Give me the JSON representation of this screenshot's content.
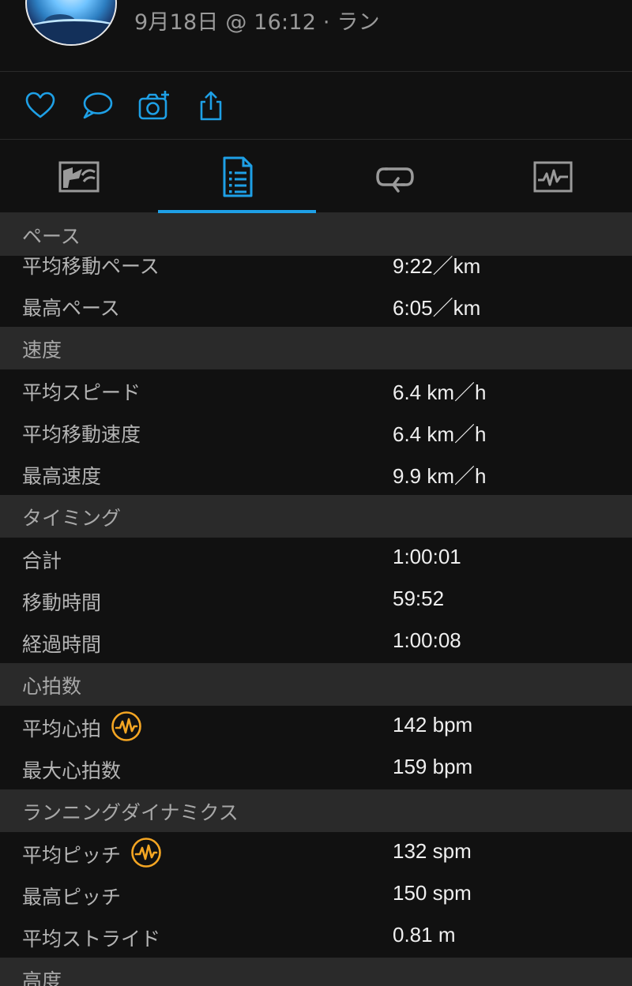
{
  "header": {
    "meta": "9月18日 @ 16:12 · ラン"
  },
  "actions": [
    {
      "icon": "heart-icon"
    },
    {
      "icon": "comment-icon"
    },
    {
      "icon": "camera-add-icon"
    },
    {
      "icon": "share-icon"
    }
  ],
  "tabs": [
    {
      "icon": "map-icon"
    },
    {
      "icon": "stats-list-icon",
      "active": true
    },
    {
      "icon": "laps-icon"
    },
    {
      "icon": "charts-icon"
    }
  ],
  "colors": {
    "accent": "#1ea0e6",
    "hr_badge": "#f5a623",
    "section_bg": "#2a2a2a",
    "row_bg": "#111111"
  },
  "sections": {
    "pace": {
      "title": "ペース",
      "rows": [
        {
          "label": "平均移動ペース",
          "value": "9:22／km"
        },
        {
          "label": "最高ペース",
          "value": "6:05／km"
        }
      ]
    },
    "speed": {
      "title": "速度",
      "rows": [
        {
          "label": "平均スピード",
          "value": "6.4 km／h"
        },
        {
          "label": "平均移動速度",
          "value": "6.4 km／h"
        },
        {
          "label": "最高速度",
          "value": "9.9 km／h"
        }
      ]
    },
    "timing": {
      "title": "タイミング",
      "rows": [
        {
          "label": "合計",
          "value": "1:00:01"
        },
        {
          "label": "移動時間",
          "value": "59:52"
        },
        {
          "label": "経過時間",
          "value": "1:00:08"
        }
      ]
    },
    "heart_rate": {
      "title": "心拍数",
      "rows": [
        {
          "label": "平均心拍",
          "value": "142 bpm",
          "badge": "heart-rate-badge-icon"
        },
        {
          "label": "最大心拍数",
          "value": "159 bpm"
        }
      ]
    },
    "running_dynamics": {
      "title": "ランニングダイナミクス",
      "rows": [
        {
          "label": "平均ピッチ",
          "value": "132 spm",
          "badge": "heart-rate-badge-icon"
        },
        {
          "label": "最高ピッチ",
          "value": "150 spm"
        },
        {
          "label": "平均ストライド",
          "value": "0.81 m"
        }
      ]
    },
    "elevation": {
      "title": "高度"
    }
  }
}
